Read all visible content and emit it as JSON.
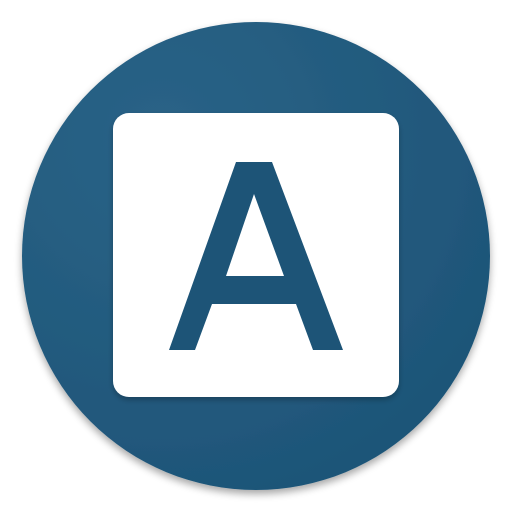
{
  "icon": {
    "name": "app-launcher-icon",
    "glyph": "A",
    "colors": {
      "circle": "#1d5477",
      "circle_highlight": "#2a6387",
      "tile": "#ffffff",
      "glyph": "#1d5477"
    }
  }
}
